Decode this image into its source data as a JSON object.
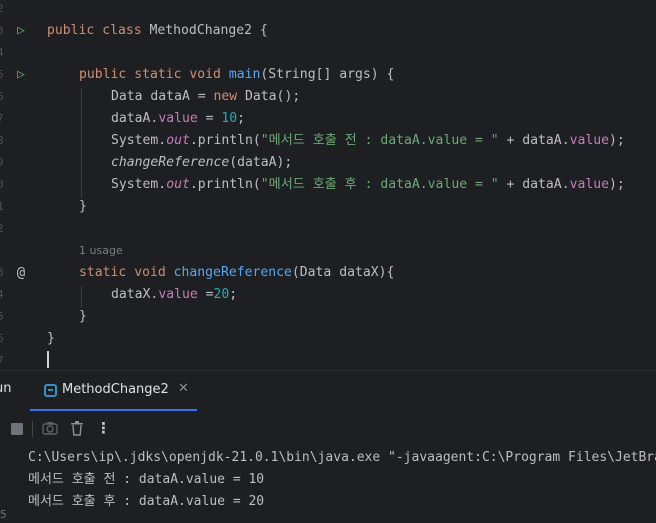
{
  "editor": {
    "line_numbers": [
      "2",
      "3",
      "4",
      "5",
      "6",
      "7",
      "8",
      "9",
      "0",
      "1",
      "2",
      "",
      "3",
      "4",
      "5",
      "6",
      "7"
    ],
    "usage_hint": "1 usage",
    "lines": {
      "class_decl": {
        "kw1": "public",
        "kw2": "class",
        "name": "MethodChange2 {"
      },
      "main_decl": {
        "kw1": "public",
        "kw2": "static",
        "kw3": "void",
        "fn": "main",
        "rest": "(String[] args) {"
      },
      "data_new": {
        "pre": "Data dataA = ",
        "kw": "new",
        "post": " Data();"
      },
      "assign": {
        "obj": "dataA.",
        "fld": "value",
        "op": " = ",
        "num": "10",
        "end": ";"
      },
      "print1": {
        "cls": "System.",
        "out": "out",
        "call": ".println(",
        "str": "\"메서드 호출 전 : dataA.value = \"",
        "plus": " + dataA.",
        "fld": "value",
        "end": ");"
      },
      "call_change": {
        "fn": "changeReference",
        "rest": "(dataA);"
      },
      "print2": {
        "cls": "System.",
        "out": "out",
        "call": ".println(",
        "str": "\"메서드 호출 후 : dataA.value = \"",
        "plus": " + dataA.",
        "fld": "value",
        "end": ");"
      },
      "close_main": "}",
      "method_decl": {
        "kw1": "static",
        "kw2": "void",
        "fn": "changeReference",
        "rest": "(Data dataX){"
      },
      "assign_x": {
        "obj": "dataX.",
        "fld": "value",
        "op": " =",
        "num": "20",
        "end": ";"
      },
      "close_method": "}",
      "close_class": "}"
    },
    "gutter_icons": {
      "run": "run-triangle-icon",
      "override": "at-sign-icon"
    }
  },
  "run_panel": {
    "label": "un",
    "tab": {
      "label": "MethodChange2",
      "close": "✕"
    },
    "toolbar": {
      "more": "⋮"
    },
    "console": {
      "lines": [
        "C:\\Users\\ip\\.jdks\\openjdk-21.0.1\\bin\\java.exe \"-javaagent:C:\\Program Files\\JetBrains",
        "메서드 호출 전 : dataA.value = 10",
        "메서드 호출 후 : dataA.value = 20"
      ],
      "edge_number": "5"
    }
  },
  "colors": {
    "background": "#1e1f22",
    "keyword": "#cf8e6d",
    "function": "#56a8f5",
    "number": "#2aacb8",
    "string": "#6aab73",
    "field": "#c77dbb",
    "run_icon": "#5fb865",
    "tab_accent": "#3574f0"
  }
}
